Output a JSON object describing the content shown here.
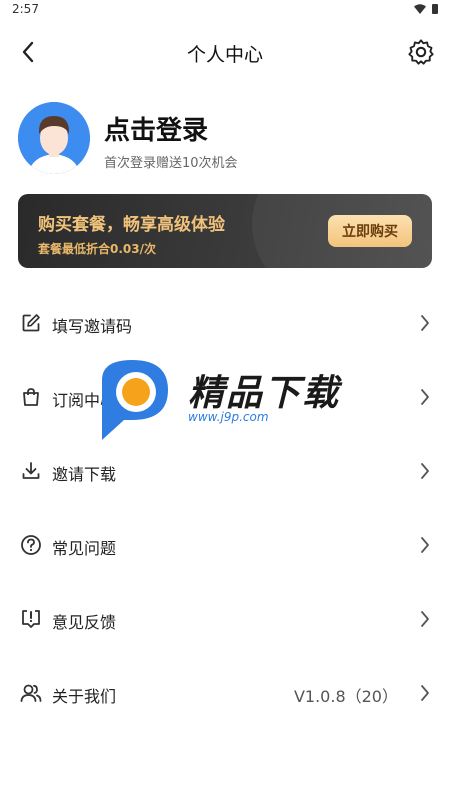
{
  "status_bar": {
    "time": "2:57"
  },
  "header": {
    "title": "个人中心"
  },
  "profile": {
    "login_text": "点击登录",
    "bonus_text": "首次登录赠送10次机会"
  },
  "vip_banner": {
    "title": "购买套餐，畅享高级体验",
    "subtitle": "套餐最低折合0.03/次",
    "button_label": "立即购买"
  },
  "menu": [
    {
      "label": "填写邀请码",
      "icon": "edit-icon"
    },
    {
      "label": "订阅中心",
      "icon": "shopping-bag-icon"
    },
    {
      "label": "邀请下载",
      "icon": "download-icon"
    },
    {
      "label": "常见问题",
      "icon": "help-circle-icon"
    },
    {
      "label": "意见反馈",
      "icon": "feedback-icon"
    },
    {
      "label": "关于我们",
      "icon": "users-icon",
      "value": "V1.0.8（20）"
    }
  ],
  "watermark": {
    "text": "精品下载",
    "url": "www.j9p.com"
  },
  "colors": {
    "accent_gold": "#f0c27b",
    "banner_bg": "#2a2a2a",
    "avatar_bg": "#3d8cf0",
    "watermark_blue": "#2f7de1"
  }
}
